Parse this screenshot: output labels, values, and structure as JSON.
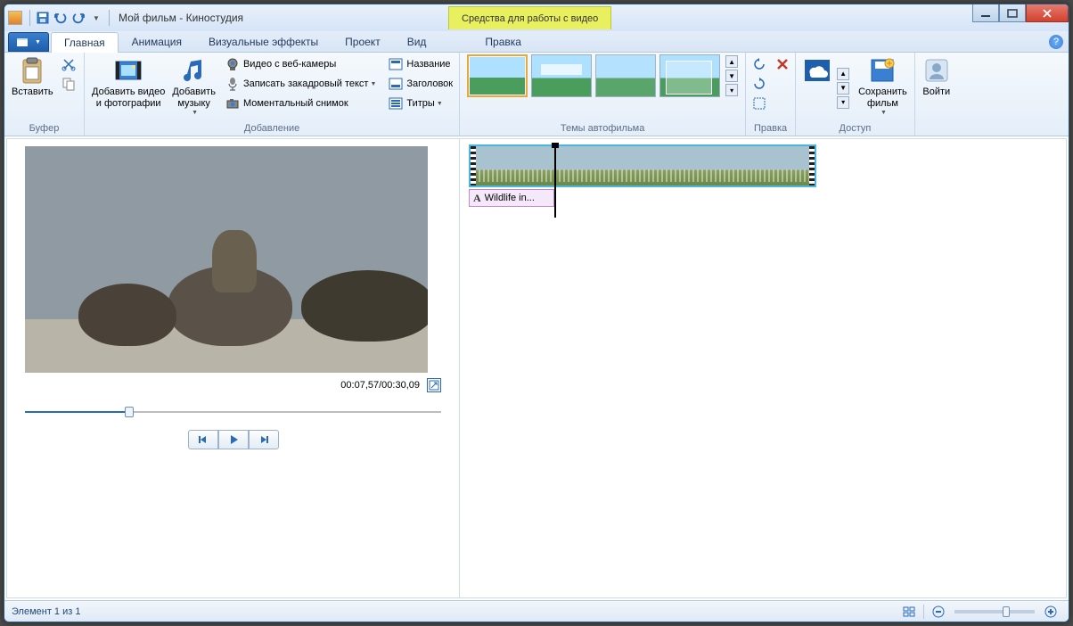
{
  "titlebar": {
    "app_title": "Мой фильм - Киностудия",
    "contextual_tab": "Средства для работы с видео"
  },
  "tabs": {
    "home": "Главная",
    "animation": "Анимация",
    "visual_effects": "Визуальные эффекты",
    "project": "Проект",
    "view": "Вид",
    "edit": "Правка"
  },
  "ribbon": {
    "buffer": {
      "label": "Буфер",
      "paste": "Вставить"
    },
    "add": {
      "label": "Добавление",
      "add_videos": "Добавить видео\nи фотографии",
      "add_music": "Добавить\nмузыку",
      "webcam": "Видео с веб-камеры",
      "narration": "Записать закадровый текст",
      "snapshot": "Моментальный снимок",
      "title_btn": "Название",
      "caption_btn": "Заголовок",
      "credits_btn": "Титры"
    },
    "themes": {
      "label": "Темы автофильма"
    },
    "edit_group": {
      "label": "Правка"
    },
    "access": {
      "label": "Доступ",
      "save_movie": "Сохранить\nфильм",
      "signin": "Войти"
    }
  },
  "preview": {
    "time_display": "00:07,57/00:30,09",
    "progress_percent": 25
  },
  "timeline": {
    "caption_text": "Wildlife in..."
  },
  "statusbar": {
    "item_text": "Элемент 1 из 1",
    "zoom_percent": 60
  }
}
